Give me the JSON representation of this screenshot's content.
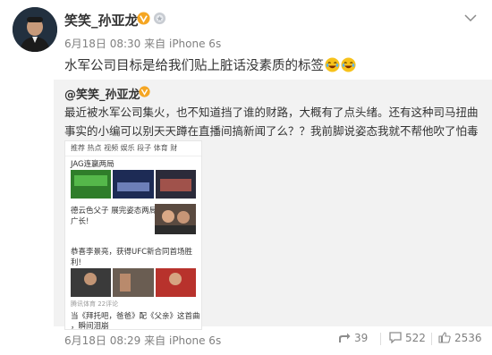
{
  "post": {
    "author": "笑笑_孙亚龙",
    "time": "6月18日 08:30",
    "source_prefix": "来自",
    "source": "iPhone 6s",
    "text": "水军公司目标是给我们贴上脏话没素质的标签"
  },
  "repost": {
    "author": "@笑笑_孙亚龙",
    "text": "最近被水军公司集火，也不知道挡了谁的财路，大概有了点头绪。还有这种司马扭曲事实的小编可以别天天蹲在直播间搞新闻了么？？我前脚说姿态我就不帮他吹了怕毒奶，立马就来？",
    "screenshot": {
      "nav_text": "推荐  热点  视频  娱乐  段子  体育  财",
      "item1_title": "JAG连赢两局",
      "item2_title": "德云色父子 展完姿态两局",
      "item2_line2": "广长!",
      "item3_title": "恭喜李景亮，获得UFC新合同首场胜",
      "item3_line2": "利!",
      "item3_caption": "腾讯体育  22评论",
      "item4_title": "当《拜托吧，爸爸》配《父亲》这首曲",
      "item4_line2": "，瞬间泪崩"
    },
    "time": "6月18日 08:29",
    "source_prefix": "来自",
    "source": "iPhone 6s",
    "repost_count": "39",
    "comment_count": "522",
    "like_count": "2536"
  }
}
